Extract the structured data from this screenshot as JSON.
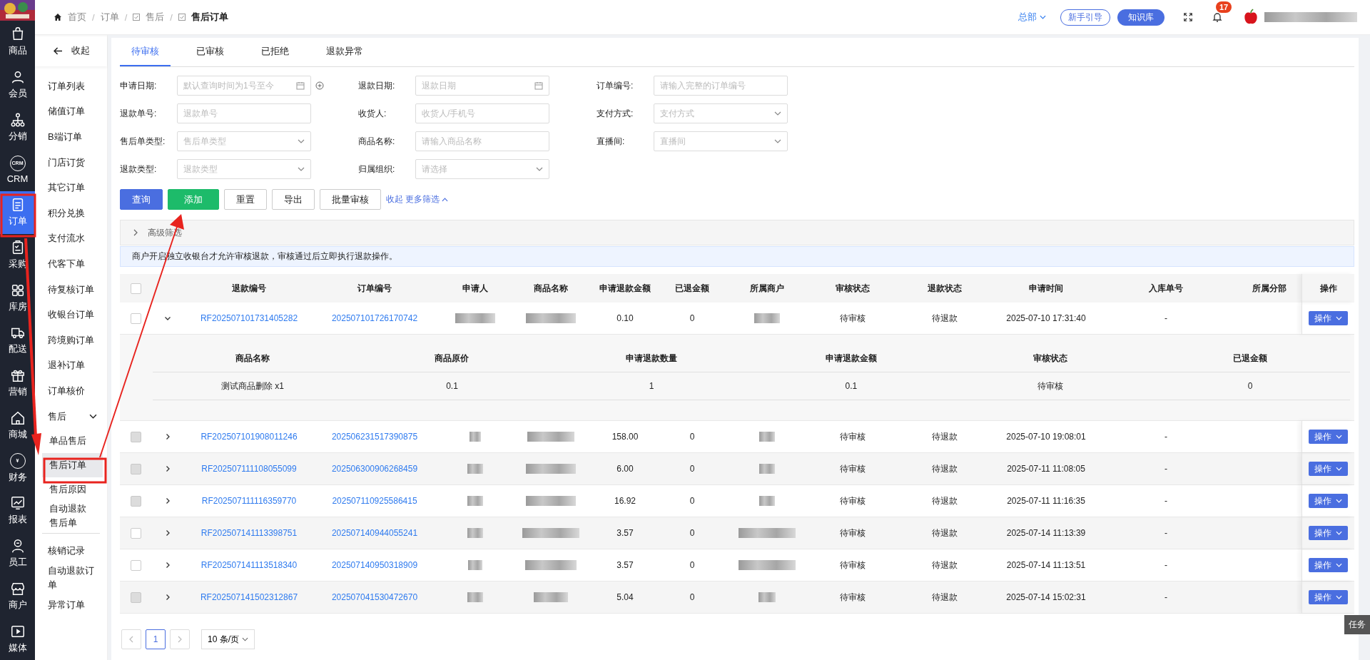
{
  "rail": {
    "items": [
      {
        "label": "商品",
        "selected": false
      },
      {
        "label": "会员",
        "selected": false
      },
      {
        "label": "分销",
        "selected": false
      },
      {
        "label": "CRM",
        "selected": false,
        "icon_text": "CRM"
      },
      {
        "label": "订单",
        "selected": true
      },
      {
        "label": "采购",
        "selected": false
      },
      {
        "label": "库房",
        "selected": false
      },
      {
        "label": "配送",
        "selected": false
      },
      {
        "label": "营销",
        "selected": false
      },
      {
        "label": "商城",
        "selected": false
      },
      {
        "label": "财务",
        "selected": false,
        "icon_text": "¥"
      },
      {
        "label": "报表",
        "selected": false
      },
      {
        "label": "员工",
        "selected": false
      },
      {
        "label": "商户",
        "selected": false
      },
      {
        "label": "媒体",
        "selected": false
      }
    ]
  },
  "breadcrumb": [
    "首页",
    "订单",
    "售后",
    "售后订单"
  ],
  "breadcrumb_separator": "/",
  "header": {
    "org": "总部",
    "guide": "新手引导",
    "knowledge": "知识库",
    "notifications": "17"
  },
  "sidebar": {
    "collapse": "收起",
    "items": [
      {
        "label": "订单列表",
        "selected": false
      },
      {
        "label": "储值订单",
        "selected": false
      },
      {
        "label": "B端订单",
        "selected": false
      },
      {
        "label": "门店订货",
        "selected": false
      },
      {
        "label": "其它订单",
        "selected": false
      },
      {
        "label": "积分兑换",
        "selected": false
      },
      {
        "label": "支付流水",
        "selected": false
      },
      {
        "label": "代客下单",
        "selected": false
      },
      {
        "label": "待复核订单",
        "selected": false
      },
      {
        "label": "收银台订单",
        "selected": false
      },
      {
        "label": "跨境购订单",
        "selected": false
      },
      {
        "label": "退补订单",
        "selected": false
      },
      {
        "label": "订单核价",
        "selected": false
      },
      {
        "label": "售后",
        "expanded": true,
        "children": [
          {
            "label": "单品售后",
            "selected": false
          },
          {
            "label": "售后订单",
            "selected": true
          },
          {
            "label": "售后原因",
            "selected": false
          },
          {
            "label": "自动退款售后单",
            "selected": false
          }
        ]
      },
      {
        "label": "核销记录",
        "selected": false
      },
      {
        "label": "自动退款订单",
        "selected": false
      },
      {
        "label": "异常订单",
        "selected": false
      }
    ]
  },
  "tabs": [
    {
      "label": "待审核",
      "selected": true
    },
    {
      "label": "已审核",
      "selected": false
    },
    {
      "label": "已拒绝",
      "selected": false
    },
    {
      "label": "退款异常",
      "selected": false
    }
  ],
  "filters": [
    {
      "label": "申请日期:",
      "kind": "date",
      "placeholder": "默认查询时间为1号至今",
      "extra": true
    },
    {
      "label": "退款日期:",
      "kind": "date",
      "placeholder": "退款日期"
    },
    {
      "label": "订单编号:",
      "kind": "text",
      "placeholder": "请输入完整的订单编号"
    },
    {
      "label": "退款单号:",
      "kind": "text",
      "placeholder": "退款单号"
    },
    {
      "label": "收货人:",
      "kind": "text",
      "placeholder": "收货人/手机号"
    },
    {
      "label": "支付方式:",
      "kind": "select",
      "placeholder": "支付方式"
    },
    {
      "label": "售后单类型:",
      "kind": "select",
      "placeholder": "售后单类型"
    },
    {
      "label": "商品名称:",
      "kind": "text",
      "placeholder": "请输入商品名称"
    },
    {
      "label": "直播间:",
      "kind": "select",
      "placeholder": "直播间"
    },
    {
      "label": "退款类型:",
      "kind": "select",
      "placeholder": "退款类型"
    },
    {
      "label": "归属组织:",
      "kind": "select",
      "placeholder": "请选择"
    }
  ],
  "actions": [
    {
      "label": "查询",
      "kind": "primary"
    },
    {
      "label": "添加",
      "kind": "success"
    },
    {
      "label": "重置",
      "kind": "plain"
    },
    {
      "label": "导出",
      "kind": "plain"
    },
    {
      "label": "批量审核",
      "kind": "plain"
    }
  ],
  "filter_links": [
    "收起",
    "更多筛选"
  ],
  "advanced_filter": {
    "label": "高级筛选",
    "expanded": false
  },
  "notice": "商户开启独立收银台才允许审核退款，审核通过后立即执行退款操作。",
  "table": {
    "select_all_checked": false,
    "columns": [
      "退款编号",
      "订单编号",
      "申请人",
      "商品名称",
      "申请退款金额",
      "已退金额",
      "所属商户",
      "审核状态",
      "退款状态",
      "申请时间",
      "入库单号",
      "所属分部",
      "操作"
    ],
    "rows": [
      {
        "refund_no": "RF202507101731405282",
        "order_no": "202507101726170742",
        "amount": "0.10",
        "refunded": "0",
        "audit": "待审核",
        "refund_status": "待退款",
        "time": "2025-07-10 17:31:40",
        "stock_no": "-",
        "action": "操作",
        "disabled": false,
        "expanded": true,
        "details": {
          "columns": [
            "商品名称",
            "商品原价",
            "申请退款数量",
            "申请退款金额",
            "审核状态",
            "已退金额"
          ],
          "rows": [
            [
              "测试商品删除 x1",
              "0.1",
              "1",
              "0.1",
              "待审核",
              "0"
            ]
          ]
        }
      },
      {
        "refund_no": "RF202507101908011246",
        "order_no": "202506231517390875",
        "amount": "158.00",
        "refunded": "0",
        "audit": "待审核",
        "refund_status": "待退款",
        "time": "2025-07-10 19:08:01",
        "stock_no": "-",
        "action": "操作",
        "disabled": true,
        "expanded": false
      },
      {
        "refund_no": "RF202507111108055099",
        "order_no": "202506300906268459",
        "amount": "6.00",
        "refunded": "0",
        "audit": "待审核",
        "refund_status": "待退款",
        "time": "2025-07-11 11:08:05",
        "stock_no": "-",
        "action": "操作",
        "disabled": true,
        "expanded": false
      },
      {
        "refund_no": "RF202507111116359770",
        "order_no": "202507110925586415",
        "amount": "16.92",
        "refunded": "0",
        "audit": "待审核",
        "refund_status": "待退款",
        "time": "2025-07-11 11:16:35",
        "stock_no": "-",
        "action": "操作",
        "disabled": true,
        "expanded": false
      },
      {
        "refund_no": "RF202507141113398751",
        "order_no": "202507140944055241",
        "amount": "3.57",
        "refunded": "0",
        "audit": "待审核",
        "refund_status": "待退款",
        "time": "2025-07-14 11:13:39",
        "stock_no": "-",
        "action": "操作",
        "disabled": false,
        "expanded": false
      },
      {
        "refund_no": "RF202507141113518340",
        "order_no": "202507140950318909",
        "amount": "3.57",
        "refunded": "0",
        "audit": "待审核",
        "refund_status": "待退款",
        "time": "2025-07-14 11:13:51",
        "stock_no": "-",
        "action": "操作",
        "disabled": false,
        "expanded": false
      },
      {
        "refund_no": "RF202507141502312867",
        "order_no": "202507041530472670",
        "amount": "5.04",
        "refunded": "0",
        "audit": "待审核",
        "refund_status": "待退款",
        "time": "2025-07-14 15:02:31",
        "stock_no": "-",
        "action": "操作",
        "disabled": true,
        "expanded": false
      }
    ]
  },
  "pagination": {
    "pages": [
      {
        "label": "1",
        "selected": true
      }
    ],
    "page_size": "10 条/页"
  },
  "task_tab": "任务"
}
